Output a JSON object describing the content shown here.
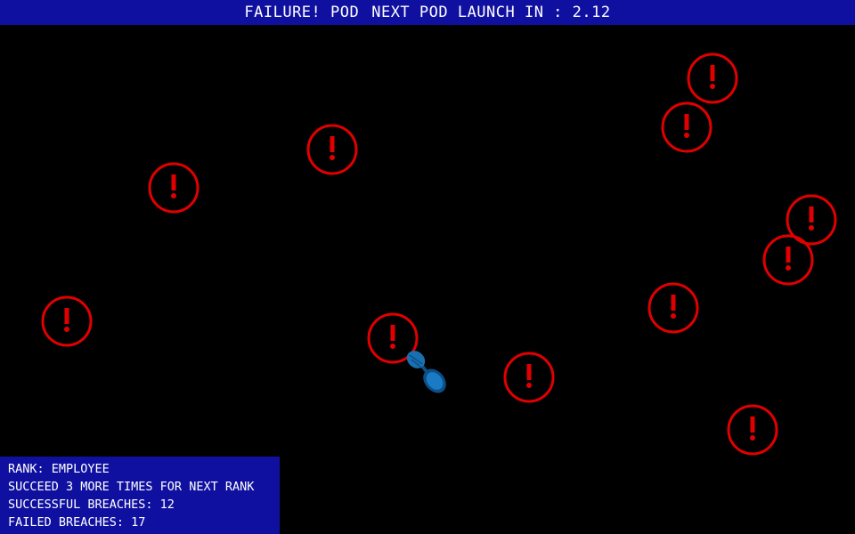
{
  "hud": {
    "status": "FAILURE! POD",
    "launch_label": "NEXT POD LAUNCH IN : 2.12"
  },
  "stats": {
    "rank": "RANK: EMPLOYEE",
    "next_rank": "SUCCEED 3 MORE TIMES FOR NEXT RANK",
    "successful": "SUCCESSFUL BREACHES: 12",
    "failed": "FAILED BREACHES: 17"
  },
  "colors": {
    "hud_bg": "#1010a0",
    "alert": "#e00000",
    "pod": "#1a7ac4"
  },
  "icons": {
    "alert": "exclamation-circle-icon",
    "pod": "pod-icon"
  }
}
